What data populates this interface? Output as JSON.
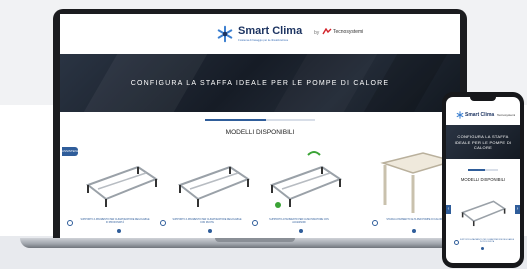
{
  "site": {
    "brand": "Smart Clima",
    "tagline": "Il sistema di fissaggio per la climatizzazione",
    "by": "by",
    "partner": "Tecnosystemi"
  },
  "hero": {
    "title": "CONFIGURA LA STAFFA IDEALE PER LE POMPE DI CALORE"
  },
  "wizard": {
    "progress": 0.55
  },
  "models": {
    "section_title": "MODELLI DISPONIBILI",
    "side_tab": "ASSISTENZA",
    "items": [
      {
        "name": "SUPPORTO A PAVIMENTO PER CLIMATIZZATORE REGOLABILE IN PROFONDITÀ"
      },
      {
        "name": "SUPPORTO A PAVIMENTO PER CLIMATIZZATORE REGOLABILE CON RUOTE"
      },
      {
        "name": "SUPPORTO A PAVIMENTO PER CLIMATIZZATORE CON ACCESSORI"
      },
      {
        "name": "STAFFA A PAVIMENTO ALTA PER POMPE DI CALORE"
      }
    ]
  },
  "mobile": {
    "hero_title": "CONFIGURA LA STAFFA IDEALE PER LE POMPE DI CALORE",
    "section_title": "MODELLI DISPONIBILI",
    "model_name": "SUPPORTO A PAVIMENTO PER CLIMATIZZATORE REGOLABILE IN PROFONDITÀ",
    "arrow_left": "‹",
    "arrow_right": "›"
  },
  "colors": {
    "brand_blue": "#2f5d9a",
    "brand_navy": "#1e3562",
    "hero_dark": "#1b222d"
  },
  "icons": [
    "snowflake-logo-icon",
    "tecnosystemi-logo-icon",
    "radio-button-icon",
    "chevron-left-icon",
    "chevron-right-icon"
  ]
}
